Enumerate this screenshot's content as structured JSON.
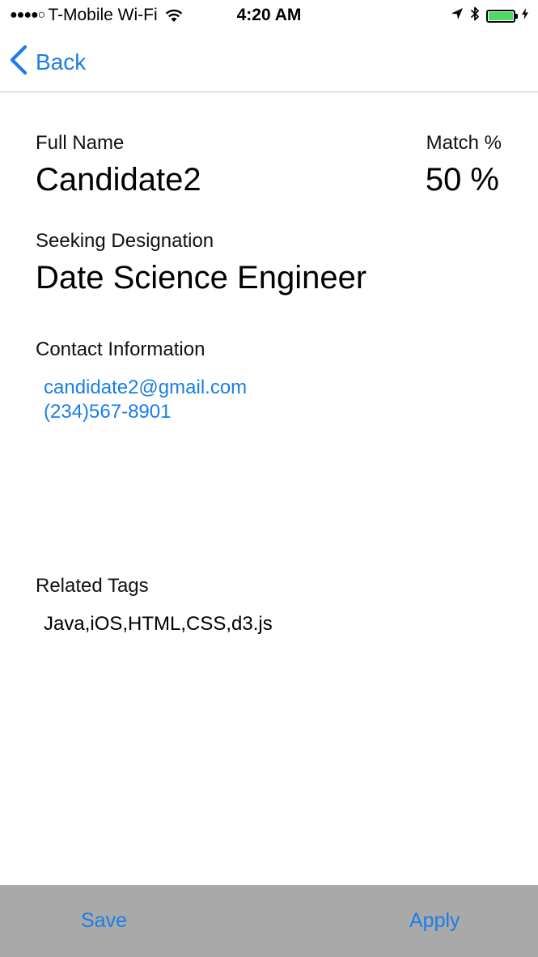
{
  "status_bar": {
    "signal": "●●●●○",
    "carrier": "T-Mobile Wi-Fi",
    "time": "4:20 AM",
    "battery_color": "#4cd964"
  },
  "nav": {
    "back_label": "Back",
    "accent_color": "#1a7ee6"
  },
  "profile": {
    "full_name_label": "Full Name",
    "full_name": "Candidate2",
    "match_label": "Match %",
    "match_value": "50 %",
    "designation_label": "Seeking Designation",
    "designation": "Date Science Engineer",
    "contact_label": "Contact Information",
    "email": "candidate2@gmail.com",
    "phone": "(234)567-8901",
    "tags_label": "Related Tags",
    "tags": "Java,iOS,HTML,CSS,d3.js"
  },
  "toolbar": {
    "save_label": "Save",
    "apply_label": "Apply",
    "background_color": "#a9a9a9"
  }
}
